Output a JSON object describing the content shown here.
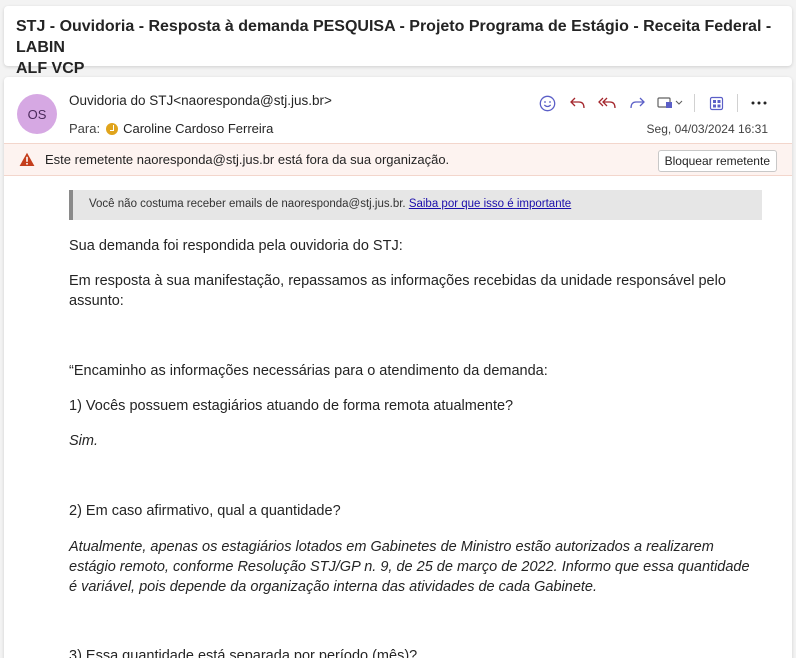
{
  "subject": {
    "line1": "STJ - Ouvidoria - Resposta à demanda PESQUISA - Projeto Programa de Estágio - Receita Federal - LABIN",
    "line2": "ALF VCP"
  },
  "header": {
    "avatar_initials": "OS",
    "from": "Ouvidoria do STJ<naoresponda@stj.jus.br>",
    "to_label": "Para:",
    "to_name": "Caroline Cardoso Ferreira",
    "date": "Seg, 04/03/2024 16:31"
  },
  "toolbar": {
    "icons": [
      "emoji-icon",
      "reply-icon",
      "reply-all-icon",
      "forward-icon",
      "apps-icon",
      "immersive-reader-icon",
      "more-icon"
    ],
    "accent": "#5b5fc7"
  },
  "warning": {
    "text": "Este remetente naoresponda@stj.jus.br está fora da sua organização.",
    "block_label": "Bloquear remetente",
    "icon_color": "#c43e1c"
  },
  "notice": {
    "text": "Você não costuma receber emails de naoresponda@stj.jus.br.",
    "link": "Saiba por que isso é importante"
  },
  "body": {
    "p1": "Sua demanda foi respondida pela ouvidoria do STJ:",
    "p2": "Em resposta à sua manifestação, repassamos as informações recebidas da unidade responsável pelo assunto:",
    "p3": "“Encaminho as informações necessárias para o atendimento da demanda:",
    "q1": "1) Vocês possuem estagiários atuando de forma remota atualmente?",
    "a1": "Sim.",
    "q2": "2) Em caso afirmativo, qual a quantidade?",
    "a2": "Atualmente, apenas os estagiários lotados em Gabinetes de Ministro estão autorizados a realizarem estágio remoto, conforme Resolução STJ/GP n. 9, de 25 de março de 2022. Informo que essa quantidade é variável, pois depende da organização interna das atividades de cada Gabinete.",
    "q3": "3) Essa quantidade está separada por período (mês)?"
  }
}
